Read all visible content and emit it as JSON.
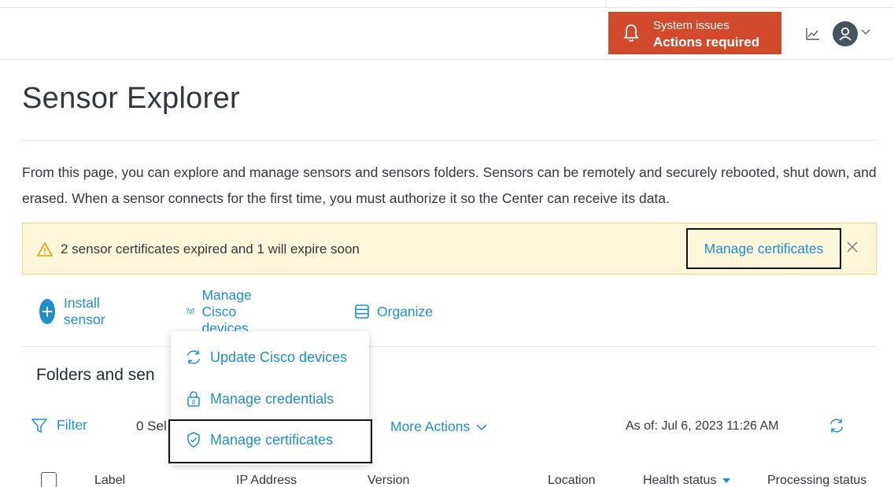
{
  "header": {
    "system_issues_line1": "System issues",
    "system_issues_line2": "Actions required"
  },
  "page": {
    "title": "Sensor Explorer",
    "description": "From this page, you can explore and manage sensors and sensors folders. Sensors can be remotely and securely rebooted, shut down, and erased. When a sensor connects for the first time, you must authorize it so the Center can receive its data."
  },
  "alert": {
    "message": "2 sensor certificates expired and 1 will expire soon",
    "link": "Manage certificates"
  },
  "actions": {
    "install": "Install sensor",
    "manage_cisco": "Manage Cisco devices",
    "organize": "Organize"
  },
  "dropdown": {
    "items": [
      {
        "label": "Update Cisco devices",
        "icon": "refresh-icon"
      },
      {
        "label": "Manage credentials",
        "icon": "lock-icon"
      },
      {
        "label": "Manage certificates",
        "icon": "shield-check-icon"
      }
    ]
  },
  "folders": {
    "heading": "Folders and sen"
  },
  "toolbar": {
    "filter": "Filter",
    "selected": "0 Sel",
    "more_actions": "More Actions",
    "as_of": "As of: Jul 6, 2023 11:26 AM"
  },
  "table": {
    "columns": [
      "Label",
      "IP Address",
      "Version",
      "Location",
      "Health status",
      "Processing status"
    ]
  },
  "colors": {
    "accent": "#1d8fcf",
    "danger": "#d14a2b",
    "alert_bg": "#fdf6d8"
  }
}
